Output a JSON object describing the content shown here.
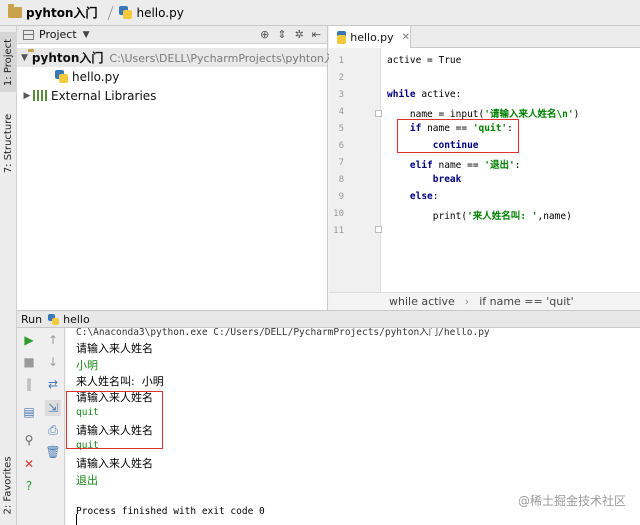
{
  "breadcrumb": {
    "project": "pyhton入门",
    "file": "hello.py"
  },
  "left_strip": {
    "project_tab": "1: Project",
    "structure_tab": "7: Structure",
    "favorites_tab": "2: Favorites"
  },
  "project_panel": {
    "header_label": "Project",
    "root_name": "pyhton入门",
    "root_path": "C:\\Users\\DELL\\PycharmProjects\\pyhton入门",
    "file": "hello.py",
    "libraries": "External Libraries"
  },
  "editor": {
    "tab_label": "hello.py",
    "line_numbers": [
      "1",
      "2",
      "3",
      "4",
      "5",
      "6",
      "7",
      "8",
      "9",
      "10",
      "11"
    ],
    "lines": [
      "active = True",
      "",
      "while active:",
      "    name = input('请输入来人姓名\\n')",
      "    if name == 'quit':",
      "        continue",
      "    elif name == '退出':",
      "        break",
      "    else:",
      "        print('来人姓名叫: ',name)",
      ""
    ],
    "breadcrumb_a": "while active",
    "breadcrumb_b": "if name == 'quit'"
  },
  "run_panel": {
    "label": "Run",
    "config": "hello",
    "console_lines": [
      "C:\\Anaconda3\\python.exe C:/Users/DELL/PycharmProjects/pyhton入门/hello.py",
      "请输入来人姓名",
      "小明",
      "来人姓名叫:  小明",
      "请输入来人姓名",
      "quit",
      "请输入来人姓名",
      "quit",
      "请输入来人姓名",
      "退出",
      "",
      "Process finished with exit code 0"
    ]
  },
  "watermark": "@稀土掘金技术社区",
  "colors": {
    "keyword": "#000080",
    "string": "#008000",
    "highlight_box": "#e03030",
    "input_echo": "#1a8a1a"
  }
}
